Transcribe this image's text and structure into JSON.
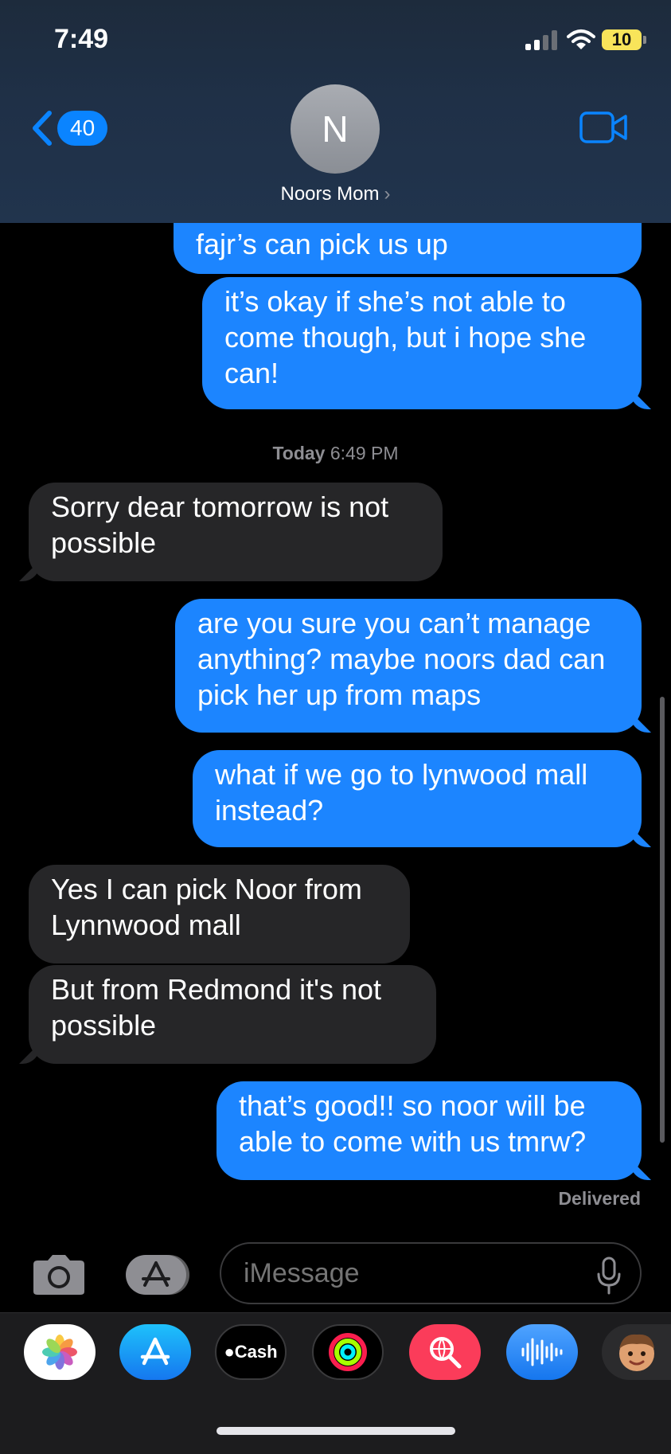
{
  "status_bar": {
    "time": "7:49",
    "battery": "10"
  },
  "header": {
    "back_count": "40",
    "avatar_initial": "N",
    "contact_name": "Noors Mom",
    "chevron": "›"
  },
  "messages": [
    {
      "dir": "out",
      "text": "fajr’s can pick us up"
    },
    {
      "dir": "out",
      "text": "it’s okay if she’s not able to come though, but i hope she can!"
    },
    {
      "dir": "in",
      "text": "Sorry dear tomorrow is not possible"
    },
    {
      "dir": "out",
      "text": "are you sure you can’t manage anything? maybe noors dad can pick her up from maps"
    },
    {
      "dir": "out",
      "text": "what if we go to lynwood mall instead?"
    },
    {
      "dir": "in",
      "text": "Yes I can pick Noor from Lynnwood mall"
    },
    {
      "dir": "in",
      "text": "But from Redmond it's not possible"
    },
    {
      "dir": "out",
      "text": "that’s good!! so noor will be able to come with us tmrw?"
    }
  ],
  "timestamp": {
    "day": "Today",
    "time": "6:49 PM"
  },
  "delivered": "Delivered",
  "composer": {
    "placeholder": "iMessage"
  },
  "app_drawer": {
    "cash_label": "Cash",
    "apps": [
      "photos-icon",
      "app-store-icon",
      "apple-cash-icon",
      "activity-icon",
      "images-search-icon",
      "audio-message-icon",
      "memoji-icon"
    ]
  },
  "colors": {
    "outgoing": "#1c85ff",
    "incoming": "#262628",
    "accent": "#0a84ff"
  }
}
